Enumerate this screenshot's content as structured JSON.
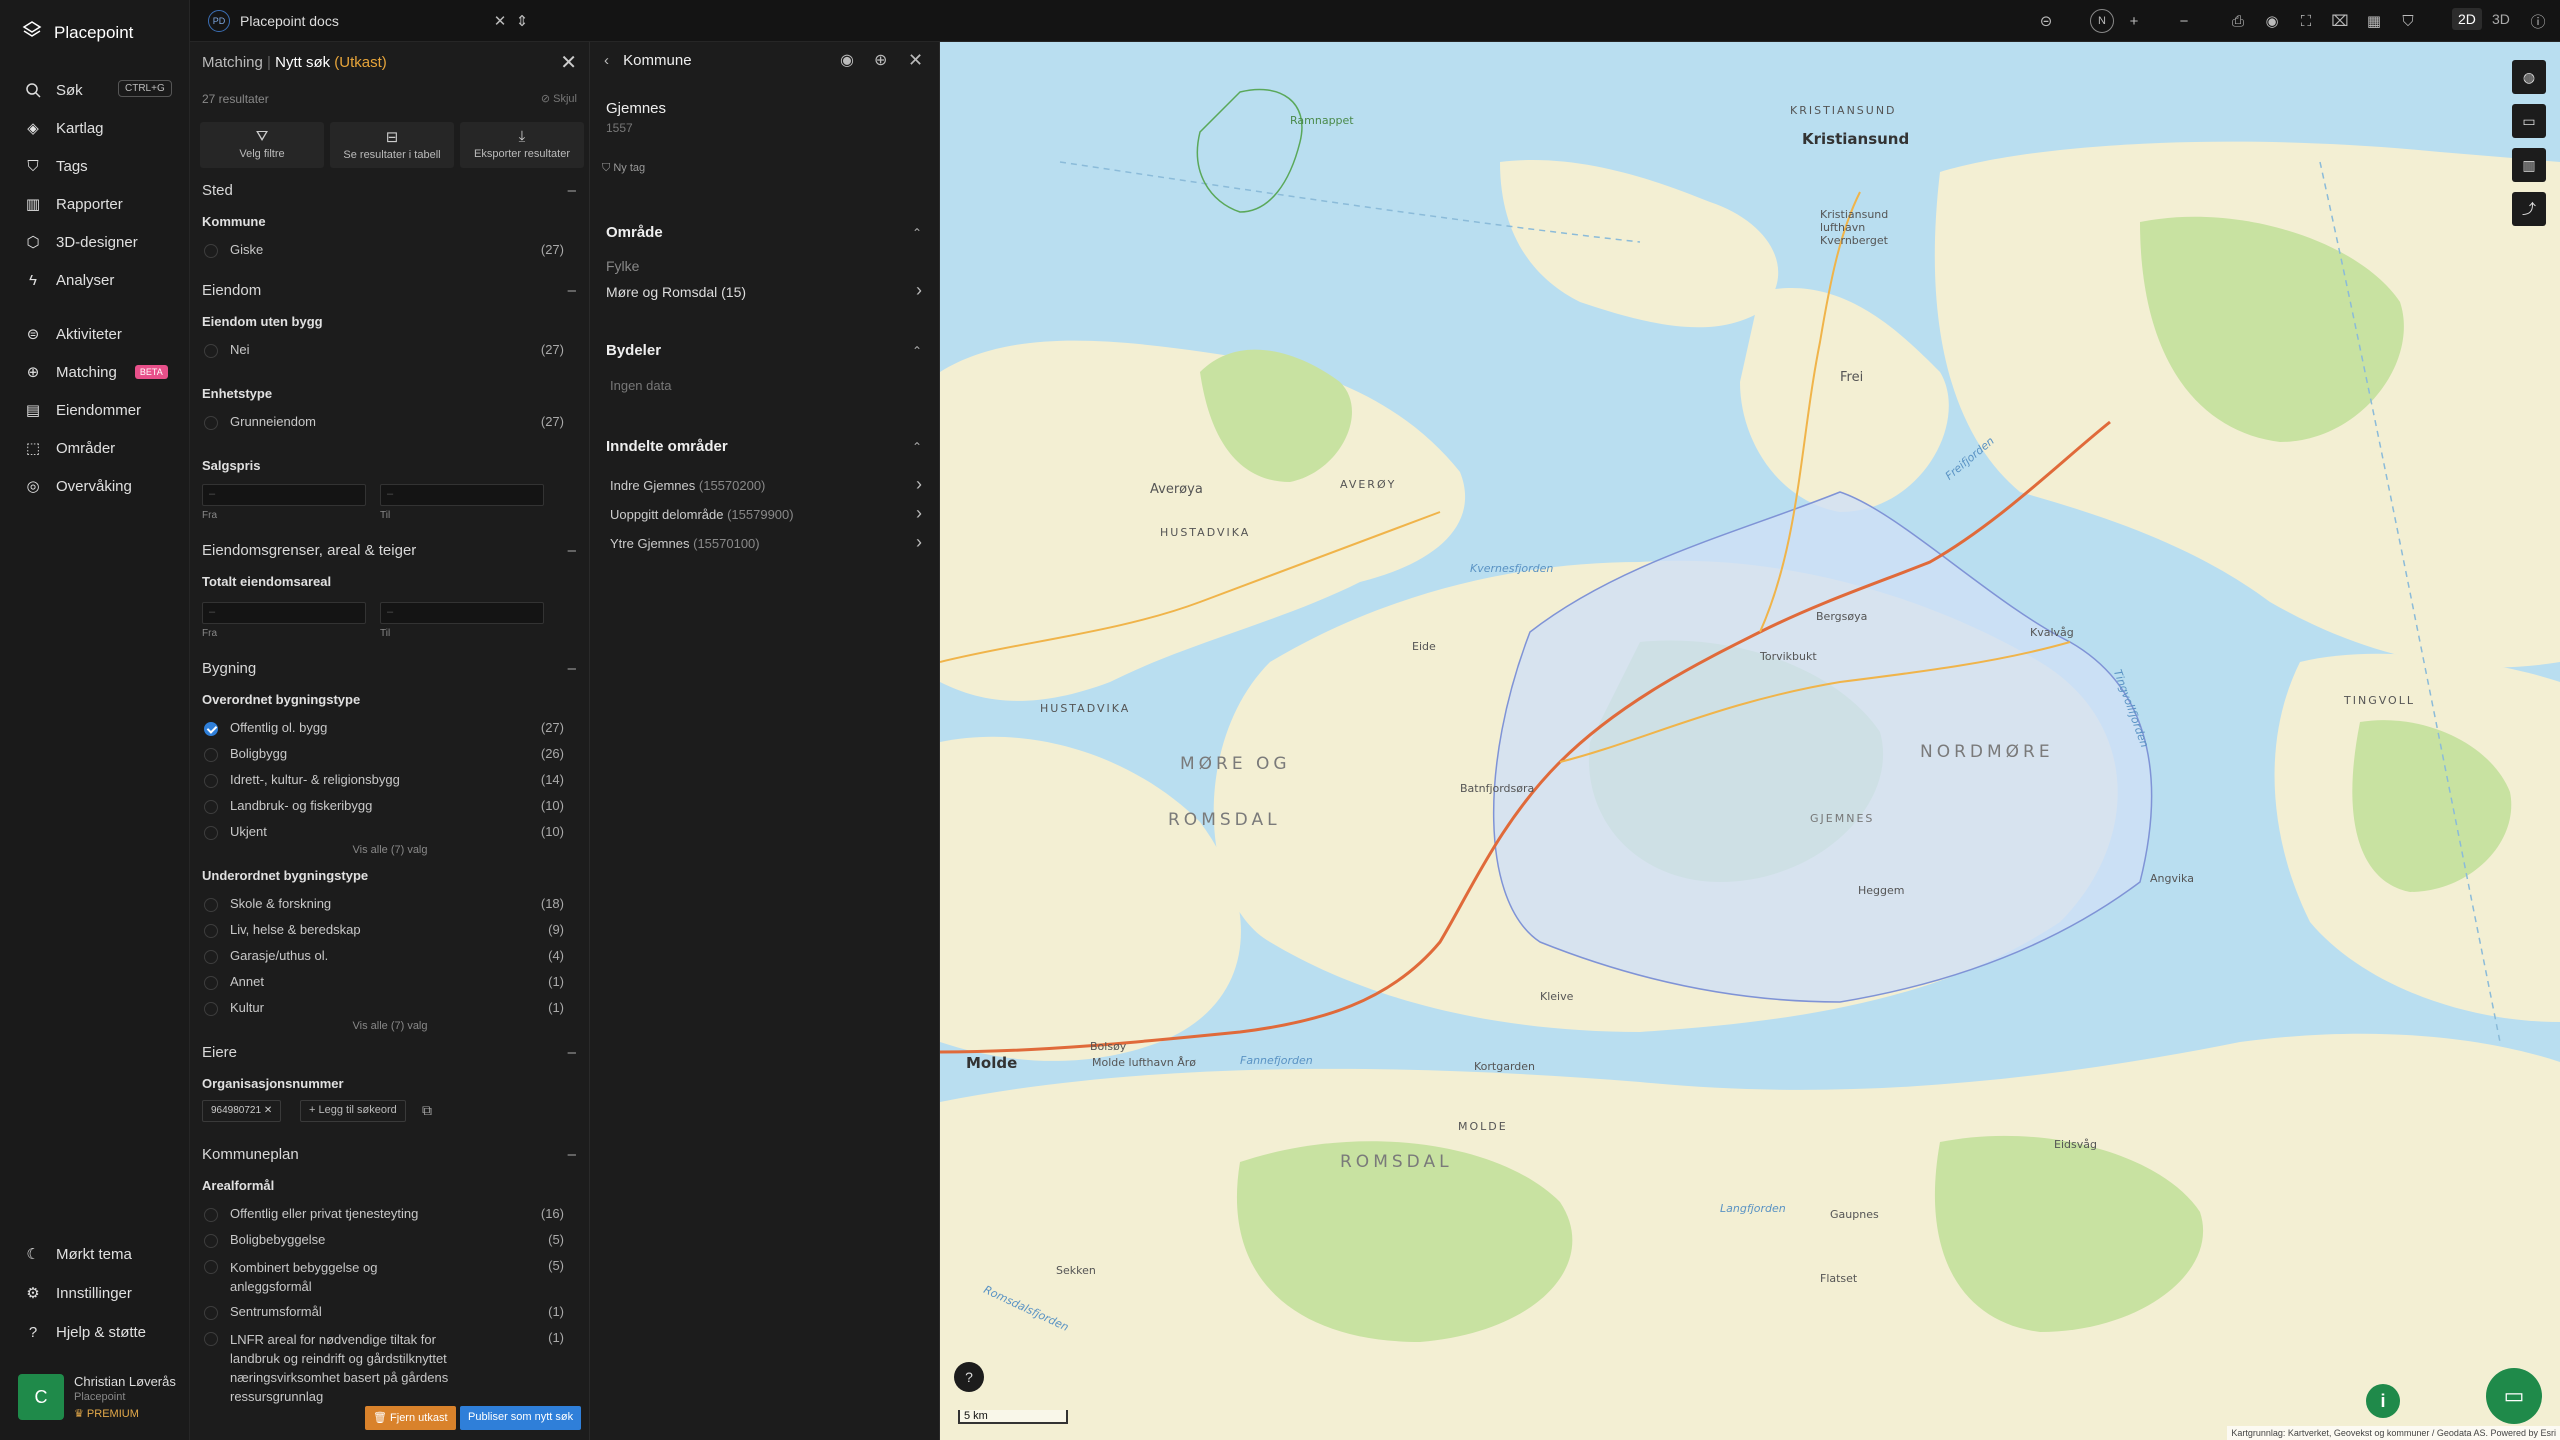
{
  "nav": {
    "brand": "Placepoint",
    "search": "Søk",
    "search_shortcut": "CTRL+G",
    "items": [
      "Kartlag",
      "Tags",
      "Rapporter",
      "3D-designer",
      "Analyser"
    ],
    "items2": [
      "Aktiviteter",
      "Matching",
      "Eiendommer",
      "Områder",
      "Overvåking"
    ],
    "beta": "BETA",
    "bottom": [
      "Mørkt tema",
      "Innstillinger",
      "Hjelp & støtte"
    ],
    "user": {
      "initial": "C",
      "name": "Christian Løverås",
      "org": "Placepoint",
      "tier": "PREMIUM"
    }
  },
  "topbar": {
    "doc_badge": "PD",
    "doc_name": "Placepoint docs",
    "north": "N",
    "mode_2d": "2D",
    "mode_3d": "3D"
  },
  "filters": {
    "crumb": "Matching",
    "title": "Nytt søk",
    "draft": "(Utkast)",
    "count": "27 resultater",
    "hide": "Skjul",
    "btn_filter": "Velg filtre",
    "btn_table": "Se resultater i tabell",
    "btn_export": "Eksporter resultater",
    "sted": "Sted",
    "kommune": "Kommune",
    "kommune_rows": [
      {
        "label": "Giske",
        "count": "(27)"
      }
    ],
    "eiendom": "Eiendom",
    "uten_bygg": "Eiendom uten bygg",
    "uten_bygg_rows": [
      {
        "label": "Nei",
        "count": "(27)"
      }
    ],
    "enhetstype": "Enhetstype",
    "enhetstype_rows": [
      {
        "label": "Grunneiendom",
        "count": "(27)"
      }
    ],
    "salgspris": "Salgspris",
    "from": "Fra",
    "to": "Til",
    "dash": "–",
    "grenser": "Eiendomsgrenser, areal & teiger",
    "totalt": "Totalt eiendomsareal",
    "bygning": "Bygning",
    "overordnet": "Overordnet bygningstype",
    "overordnet_rows": [
      {
        "label": "Offentlig ol. bygg",
        "count": "(27)",
        "checked": true
      },
      {
        "label": "Boligbygg",
        "count": "(26)"
      },
      {
        "label": "Idrett-, kultur- & religionsbygg",
        "count": "(14)"
      },
      {
        "label": "Landbruk- og fiskeribygg",
        "count": "(10)"
      },
      {
        "label": "Ukjent",
        "count": "(10)"
      }
    ],
    "view_all": "Vis alle (7) valg",
    "underordnet": "Underordnet bygningstype",
    "underordnet_rows": [
      {
        "label": "Skole & forskning",
        "count": "(18)"
      },
      {
        "label": "Liv, helse & beredskap",
        "count": "(9)"
      },
      {
        "label": "Garasje/uthus ol.",
        "count": "(4)"
      },
      {
        "label": "Annet",
        "count": "(1)"
      },
      {
        "label": "Kultur",
        "count": "(1)"
      }
    ],
    "eiere": "Eiere",
    "orgnr": "Organisasjonsnummer",
    "orgnr_chip": "964980721",
    "add_keyword": "Legg til søkeord",
    "kommuneplan": "Kommuneplan",
    "arealformal": "Arealformål",
    "areal_rows": [
      {
        "label": "Offentlig eller privat tjenesteyting",
        "count": "(16)"
      },
      {
        "label": "Boligbebyggelse",
        "count": "(5)"
      },
      {
        "label": "Kombinert bebyggelse og anleggsformål",
        "count": "(5)"
      },
      {
        "label": "Sentrumsformål",
        "count": "(1)"
      },
      {
        "label": "LNFR areal for nødvendige tiltak for landbruk og reindrift og gårdstilknyttet næringsvirksomhet basert på gårdens ressursgrunnlag",
        "count": "(1)"
      }
    ],
    "remove_draft": "Fjern utkast",
    "publish": "Publiser som nytt søk"
  },
  "detail": {
    "header": "Kommune",
    "name": "Gjemnes",
    "code": "1557",
    "new_tag": "Ny tag",
    "omrade": "Område",
    "fylke_label": "Fylke",
    "fylke_value": "Møre og Romsdal (15)",
    "bydeler": "Bydeler",
    "no_data": "Ingen data",
    "inndelte": "Inndelte områder",
    "areas": [
      {
        "name": "Indre Gjemnes",
        "code": "(15570200)"
      },
      {
        "name": "Uoppgitt delområde",
        "code": "(15579900)"
      },
      {
        "name": "Ytre Gjemnes",
        "code": "(15570100)"
      }
    ]
  },
  "map": {
    "labels": {
      "kristiansund": "Kristiansund",
      "kristiansund_caps": "KRISTIANSUND",
      "nordmore": "NORDMØRE",
      "more_og": "MØRE OG",
      "romsdal": "ROMSDAL",
      "romsdal2": "ROMSDAL",
      "gjemnes": "GJEMNES",
      "averoy": "Averøya",
      "averoy_caps": "AVERØY",
      "hustadvika": "HUSTADVIKA",
      "hustadvika2": "HUSTADVIKA",
      "molde": "Molde",
      "molde_caps": "MOLDE",
      "tingvoll": "TINGVOLL",
      "frei": "Frei",
      "fannefjorden": "Fannefjorden",
      "langfjorden": "Langfjorden",
      "romsdalsfjorden": "Romsdalsfjorden",
      "kvernesfjorden": "Kvernesfjorden",
      "freifjorden": "Freifjorden",
      "tingvollfjorden": "Tingvollfjorden",
      "ramnappet": "Ramnappet",
      "eide": "Eide",
      "batnfjordsora": "Batnfjordsøra",
      "eidsvag": "Eidsvåg",
      "angvika": "Angvika",
      "torvikbukt": "Torvikbukt",
      "kvalvag": "Kvalvåg",
      "bergsoya": "Bergsøya",
      "heggem": "Heggem",
      "kleive": "Kleive",
      "kortgarden": "Kortgarden",
      "bolsoy": "Bolsøy",
      "molde_lufthavn": "Molde lufthavn Årø",
      "kristiansund_lufthavn": "Kristiansund lufthavn Kvernberget",
      "gaupnes": "Gaupnes",
      "sekken": "Sekken",
      "flatset": "Flatset"
    },
    "scale": "5 km",
    "attribution": "Kartgrunnlag: Kartverket, Geovekst og kommuner / Geodata AS. Powered by Esri"
  },
  "colors": {
    "water": "#b9def0",
    "land": "#f3efd3",
    "forest": "#c8e2a1",
    "selected_area": "#cfe0f6",
    "accent_blue": "#2f7fd9",
    "draft_orange": "#e6a43a",
    "brand_green": "#1f8a4a"
  }
}
